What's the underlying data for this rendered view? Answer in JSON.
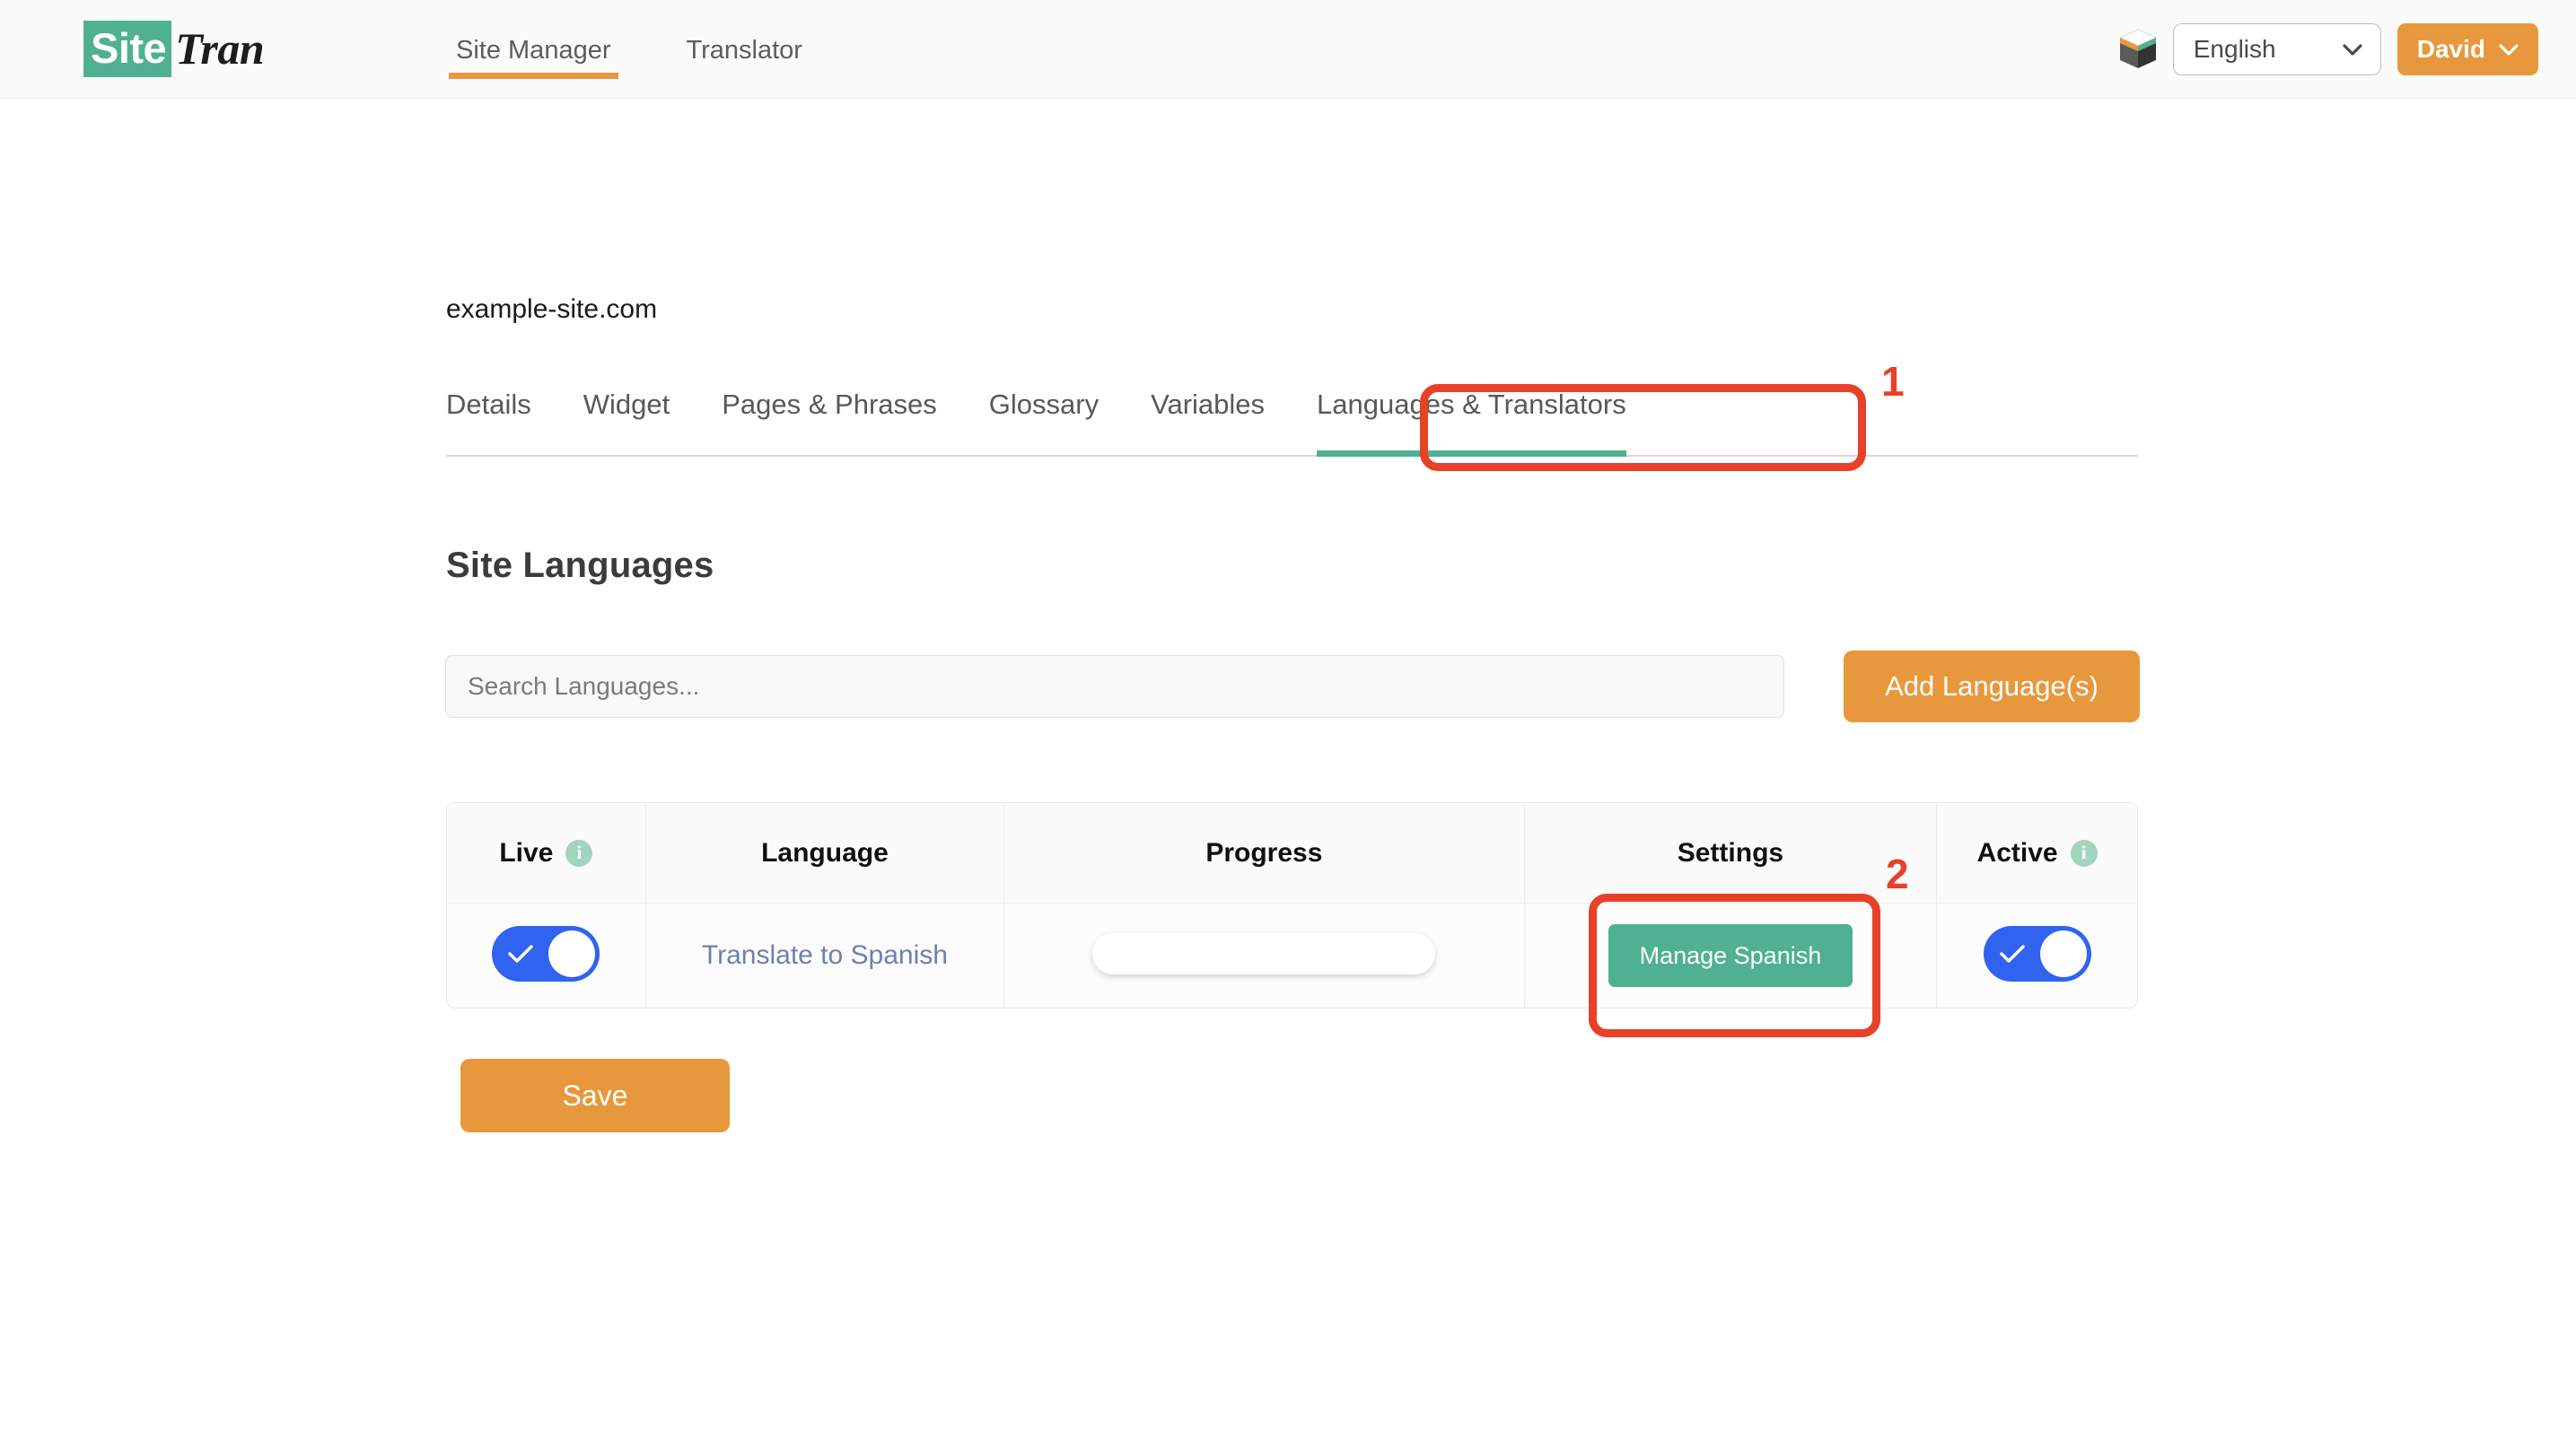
{
  "brand": {
    "mark": "Site",
    "word": "Tran"
  },
  "topnav": {
    "items": [
      {
        "label": "Site Manager",
        "active": true
      },
      {
        "label": "Translator",
        "active": false
      }
    ],
    "cube_icon": "cube-icon",
    "language_select": {
      "value": "English",
      "chevron": "chevron-down-icon"
    },
    "user_menu": {
      "label": "David",
      "chevron": "chevron-down-icon"
    }
  },
  "page": {
    "site_domain": "example-site.com",
    "subtabs": [
      {
        "label": "Details",
        "active": false
      },
      {
        "label": "Widget",
        "active": false
      },
      {
        "label": "Pages & Phrases",
        "active": false
      },
      {
        "label": "Glossary",
        "active": false
      },
      {
        "label": "Variables",
        "active": false
      },
      {
        "label": "Languages & Translators",
        "active": true
      }
    ],
    "section_title": "Site Languages",
    "search": {
      "value": "",
      "placeholder": "Search Languages..."
    },
    "add_language_label": "Add Language(s)",
    "save_label": "Save"
  },
  "table": {
    "headers": {
      "live": "Live",
      "language": "Language",
      "progress": "Progress",
      "settings": "Settings",
      "active": "Active"
    },
    "info_glyph": "i",
    "rows": [
      {
        "live_on": true,
        "language": "Translate to Spanish",
        "progress_percent": 3,
        "settings_label": "Manage Spanish",
        "active_on": true
      }
    ]
  },
  "annotations": [
    {
      "number": "1",
      "target": "Languages & Translators tab"
    },
    {
      "number": "2",
      "target": "Manage Spanish button"
    }
  ],
  "colors": {
    "brand_green": "#4fb191",
    "accent_orange": "#e8983c",
    "toggle_blue": "#2f63f0",
    "annotation_red": "#e8412a",
    "link_blue": "#6f7fb3"
  }
}
